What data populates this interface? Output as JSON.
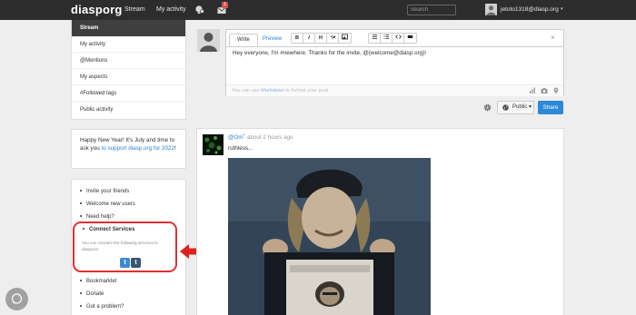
{
  "topbar": {
    "brand": "diasporg",
    "nav_stream": "Stream",
    "nav_activity": "My activity",
    "notif_count": "1",
    "search_placeholder": "Search",
    "user_name": "jetoto1318@diasp.org",
    "user_caret": "▾"
  },
  "sidebar": {
    "items": [
      {
        "label": "Stream"
      },
      {
        "label": "My activity"
      },
      {
        "label": "@Mentions"
      },
      {
        "label": "My aspects"
      },
      {
        "label": "#Followed tags"
      },
      {
        "label": "Public activity"
      }
    ]
  },
  "announcement": {
    "text_before": "Happy New Year! It's July and time to ask you ",
    "link": "to support diasp.org for 2022",
    "text_after": "!"
  },
  "lower_links": {
    "invite": "Invite your friends",
    "welcome": "Welcome new users",
    "help": "Need help?",
    "connect_title": "Connect Services",
    "connect_desc": "You can connect the following services to diaspora:",
    "twitter_glyph": "t",
    "tumblr_glyph": "t",
    "bookmarklet": "Bookmarklet",
    "donate": "Donate",
    "problem": "Got a problem?"
  },
  "publisher": {
    "tab_write": "Write",
    "tab_preview": "Preview",
    "fmt_bold": "B",
    "fmt_italic": "I",
    "fmt_heading": "H",
    "close": "×",
    "text": "Hey everyone, I'm #newhere. Thanks for the invite, @{welcome@diasp.org}!",
    "hint_before": "You can use ",
    "hint_link": "Markdown",
    "hint_after": " to format your post"
  },
  "controls": {
    "aspect_label": "Public ▾",
    "share_label": "Share"
  },
  "post": {
    "author": "@Om˜",
    "time": "· about 2 hours ago",
    "text": "ruthless..."
  },
  "colors": {
    "topbar": "#2d2d2d",
    "accent": "#2e80d4",
    "share": "#2c88d9",
    "highlight": "#e03030",
    "badge": "#d9534f"
  },
  "icons": [
    "mention-icon",
    "mail-icon",
    "user-avatar",
    "gear-icon",
    "globe-icon",
    "chart-icon",
    "camera-icon",
    "location-icon",
    "chat-icon",
    "arrow-left-icon"
  ]
}
